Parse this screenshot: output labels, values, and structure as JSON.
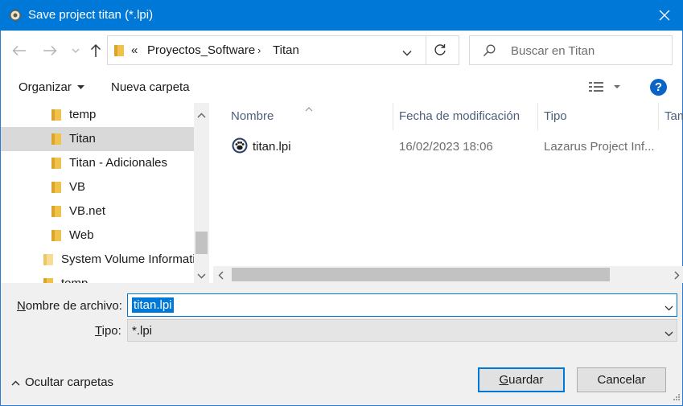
{
  "window": {
    "title": "Save project titan (*.lpi)",
    "app_icon": "lazarus-gear-icon",
    "close_icon": "close-icon"
  },
  "nav": {
    "back_icon": "back-arrow-icon",
    "forward_icon": "forward-arrow-icon",
    "recent_icon": "chevron-down-icon",
    "up_icon": "up-arrow-icon",
    "overflow": "«",
    "breadcrumb": [
      "Proyectos_Software",
      "Titan"
    ],
    "separator": "›",
    "search_placeholder": "Buscar en Titan"
  },
  "toolbar": {
    "organize": "Organizar",
    "new_folder": "Nueva carpeta",
    "help": "?"
  },
  "tree": {
    "items": [
      {
        "label": "temp",
        "selected": false,
        "indent": 1
      },
      {
        "label": "Titan",
        "selected": true,
        "indent": 1
      },
      {
        "label": "Titan - Adicionales",
        "selected": false,
        "indent": 1
      },
      {
        "label": "VB",
        "selected": false,
        "indent": 1
      },
      {
        "label": "VB.net",
        "selected": false,
        "indent": 1
      },
      {
        "label": "Web",
        "selected": false,
        "indent": 1
      },
      {
        "label": "System Volume Informati",
        "selected": false,
        "indent": 0
      },
      {
        "label": "temp",
        "selected": false,
        "indent": 0
      }
    ]
  },
  "file_list": {
    "columns": [
      "Nombre",
      "Fecha de modificación",
      "Tipo",
      "Tam"
    ],
    "rows": [
      {
        "name": "titan.lpi",
        "date": "16/02/2023 18:06",
        "type": "Lazarus Project Inf...",
        "icon": "lazarus-paw-icon"
      }
    ]
  },
  "form": {
    "filename_label_ul": "N",
    "filename_label_rest": "ombre de archivo:",
    "filename_value": "titan.lpi",
    "type_label_ul": "T",
    "type_label_rest": "ipo:",
    "type_value": "*.lpi"
  },
  "footer": {
    "hide_folders": "Ocultar carpetas",
    "save_ul": "G",
    "save_rest": "uardar",
    "cancel": "Cancelar"
  },
  "colors": {
    "titlebar": "#0078d7",
    "accent": "#0078d7",
    "folder": "#f0c24a"
  }
}
